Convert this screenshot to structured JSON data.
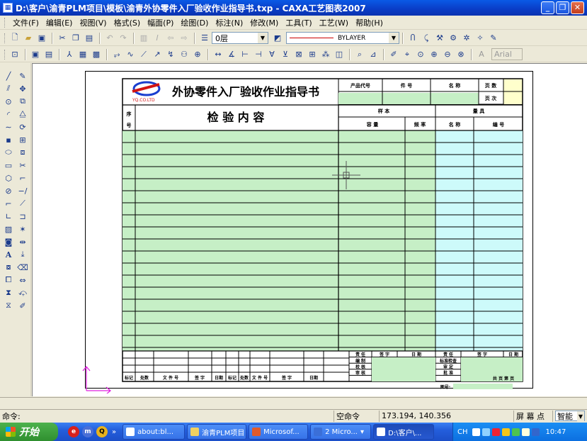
{
  "window": {
    "title": "D:\\客户\\渝青PLM项目\\模板\\渝青外协零件入厂验收作业指导书.txp - CAXA工艺图表2007",
    "minimize": "_",
    "restore": "❐",
    "close": "✕"
  },
  "menu": [
    "文件(F)",
    "编辑(E)",
    "视图(V)",
    "格式(S)",
    "幅面(P)",
    "绘图(D)",
    "标注(N)",
    "修改(M)",
    "工具(T)",
    "工艺(W)",
    "帮助(H)"
  ],
  "toolbar": {
    "layer_value": "0层",
    "linetype_value": "BYLAYER",
    "font_value": "Arial"
  },
  "form": {
    "logo_text": "YQ.CO.LTD",
    "title": "外协零件入厂验收作业指导书",
    "top_headers": [
      "产品代号",
      "件 号",
      "名 称",
      "页 数",
      "页 次"
    ],
    "seq_label": "序号",
    "content_header": "检 验 内 容",
    "sample_header": "样 本",
    "tool_header": "量 具",
    "sample_cols": [
      "容 量",
      "频 率"
    ],
    "tool_cols": [
      "名 称",
      "编 号"
    ],
    "footer_right_headers": [
      "责 任",
      "签 字",
      "日 期",
      "责 任",
      "签 字",
      "日 期"
    ],
    "footer_roles_left": [
      "编 制",
      "校 核",
      "审 核"
    ],
    "footer_roles_right": [
      "标准检查",
      "审 定",
      "批 准"
    ],
    "footer_bottom_labels": [
      "标记",
      "处数",
      "文 件 号",
      "签 字",
      "日期",
      "标记",
      "处数",
      "文 件 号",
      "签 字",
      "日期"
    ],
    "total_label": "共 页 第 页",
    "sheet_no_label": "图号:"
  },
  "status": {
    "command_label": "命令:",
    "command_state": "空命令",
    "coordinates": "173.194, 140.356",
    "snap_label": "屏 幕 点",
    "mode_value": "智能"
  },
  "taskbar": {
    "start_label": "开始",
    "tasks": [
      "about:bl...",
      "渝青PLM项目",
      "Microsof...",
      "2 Micro...",
      "D:\\客户\\..."
    ],
    "tray_lang": "CH",
    "clock": "10:47"
  },
  "colors": {
    "title_blue": "#0a3ec8",
    "form_green": "#c6efc6",
    "form_cyan": "#cdfafa",
    "ucs_magenta": "#e020e0",
    "line_red": "#cc0000"
  }
}
